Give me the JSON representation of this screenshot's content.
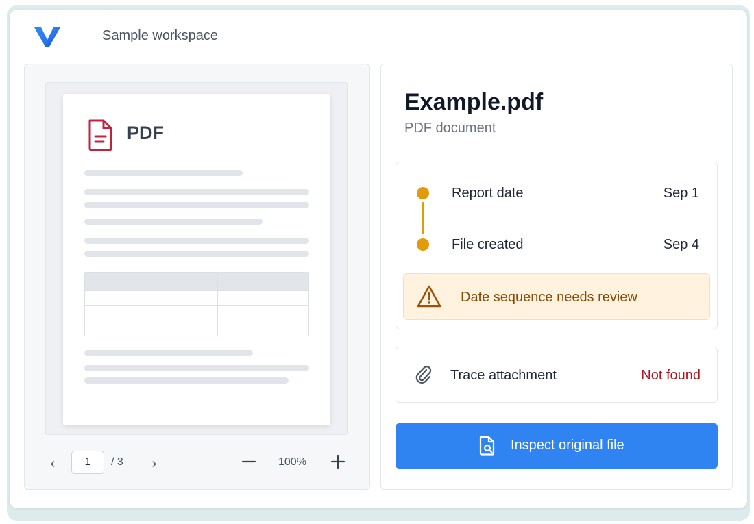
{
  "header": {
    "workspace_name": "Sample workspace",
    "logo_icon": "v-logo-icon"
  },
  "preview": {
    "doc_type_label": "PDF",
    "doc_icon": "pdf-file-icon",
    "pager": {
      "current_page": "1",
      "total_label": "/ 3",
      "prev_icon": "chevron-left-icon",
      "next_icon": "chevron-right-icon",
      "zoom_level": "100%",
      "zoom_out_icon": "minus-icon",
      "zoom_in_icon": "plus-icon"
    }
  },
  "details": {
    "file_title": "Example.pdf",
    "file_type": "PDF document",
    "timeline": [
      {
        "label": "Report date",
        "value": "Sep 1"
      },
      {
        "label": "File created",
        "value": "Sep 4"
      }
    ],
    "warning": {
      "icon": "warning-triangle-icon",
      "text": "Date sequence needs review"
    },
    "attachment": {
      "icon": "paperclip-icon",
      "label": "Trace attachment",
      "status": "Not found"
    },
    "inspect_button": {
      "icon": "file-search-icon",
      "label": "Inspect original file"
    }
  },
  "colors": {
    "accent": "#2f84f2",
    "timeline_dot": "#e39a0b",
    "warning_bg": "#fff3e0",
    "warning_text": "#8a4a06",
    "error_text": "#b0141f",
    "pdf_icon": "#c0233f",
    "logo_blue": "#1f6fe0"
  }
}
